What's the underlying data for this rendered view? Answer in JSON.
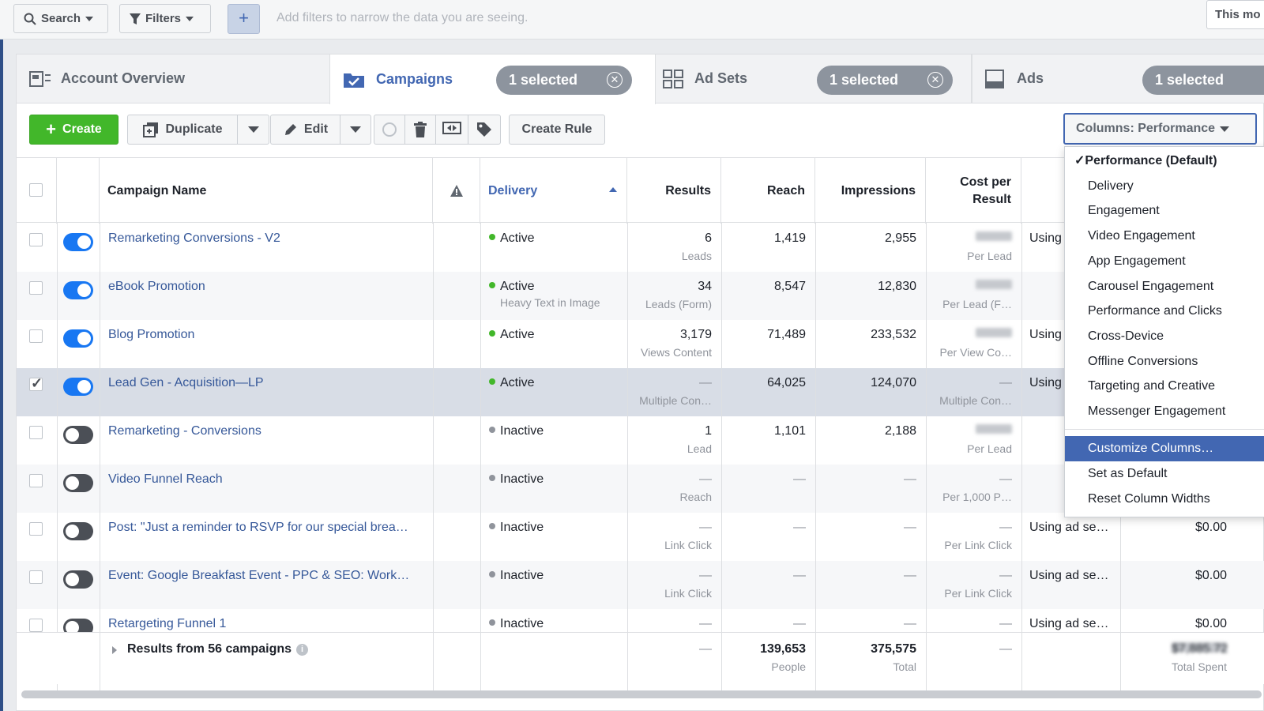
{
  "filter_bar": {
    "search_label": "Search",
    "filters_label": "Filters",
    "add_label": "+",
    "hint": "Add filters to narrow the data you are seeing.",
    "date_range": "This mo"
  },
  "tabs": [
    {
      "label": "Account Overview",
      "selected": ""
    },
    {
      "label": "Campaigns",
      "selected": "1 selected"
    },
    {
      "label": "Ad Sets",
      "selected": "1 selected"
    },
    {
      "label": "Ads",
      "selected": "1 selected"
    }
  ],
  "toolbar": {
    "create": "Create",
    "duplicate": "Duplicate",
    "edit": "Edit",
    "create_rule": "Create Rule",
    "columns": "Columns: Performance"
  },
  "headers": {
    "name": "Campaign Name",
    "delivery": "Delivery",
    "results": "Results",
    "reach": "Reach",
    "impressions": "Impressions",
    "cost_line1": "Cost per",
    "cost_line2": "Result"
  },
  "rows": [
    {
      "name": "Remarketing Conversions - V2",
      "on": true,
      "checked": false,
      "delivery": "Active",
      "delivery_sub": "",
      "results": "6",
      "results_sub": "Leads",
      "reach": "1,419",
      "impressions": "2,955",
      "cost": "$18.14",
      "cost_sub": "Per Lead",
      "budget": "Using",
      "spent": ""
    },
    {
      "name": "eBook Promotion",
      "on": true,
      "checked": false,
      "delivery": "Active",
      "delivery_sub": "Heavy Text in Image",
      "results": "34",
      "results_sub": "Leads (Form)",
      "reach": "8,547",
      "impressions": "12,830",
      "cost": "$17.47",
      "cost_sub": "Per Lead (F…",
      "budget": "",
      "spent": ""
    },
    {
      "name": "Blog Promotion",
      "on": true,
      "checked": false,
      "delivery": "Active",
      "delivery_sub": "",
      "results": "3,179",
      "results_sub": "Views Content",
      "reach": "71,489",
      "impressions": "233,532",
      "cost": "$0.23",
      "cost_sub": "Per View Co…",
      "budget": "Using",
      "spent": ""
    },
    {
      "name": "Lead Gen - Acquisition—LP",
      "on": true,
      "checked": true,
      "delivery": "Active",
      "delivery_sub": "",
      "results": "—",
      "results_sub": "Multiple Con…",
      "reach": "64,025",
      "impressions": "124,070",
      "cost": "—",
      "cost_sub": "Multiple Con…",
      "budget": "Using",
      "spent": ""
    },
    {
      "name": "Remarketing - Conversions",
      "on": false,
      "checked": false,
      "delivery": "Inactive",
      "delivery_sub": "",
      "results": "1",
      "results_sub": "Lead",
      "reach": "1,101",
      "impressions": "2,188",
      "cost": "$83.49",
      "cost_sub": "Per Lead",
      "budget": "",
      "spent": ""
    },
    {
      "name": "Video Funnel Reach",
      "on": false,
      "checked": false,
      "delivery": "Inactive",
      "delivery_sub": "",
      "results": "—",
      "results_sub": "Reach",
      "reach": "—",
      "impressions": "—",
      "cost": "—",
      "cost_sub": "Per 1,000 P…",
      "budget": "",
      "spent": ""
    },
    {
      "name": "Post: \"Just a reminder to RSVP for our special brea…",
      "on": false,
      "checked": false,
      "delivery": "Inactive",
      "delivery_sub": "",
      "results": "—",
      "results_sub": "Link Click",
      "reach": "—",
      "impressions": "—",
      "cost": "—",
      "cost_sub": "Per Link Click",
      "budget": "Using ad se…",
      "spent": "$0.00"
    },
    {
      "name": "Event: Google Breakfast Event - PPC & SEO: Work…",
      "on": false,
      "checked": false,
      "delivery": "Inactive",
      "delivery_sub": "",
      "results": "—",
      "results_sub": "Link Click",
      "reach": "—",
      "impressions": "—",
      "cost": "—",
      "cost_sub": "Per Link Click",
      "budget": "Using ad se…",
      "spent": "$0.00"
    },
    {
      "name": "Retargeting Funnel 1",
      "on": false,
      "checked": false,
      "delivery": "Inactive",
      "delivery_sub": "",
      "results": "—",
      "results_sub": "",
      "reach": "—",
      "impressions": "—",
      "cost": "—",
      "cost_sub": "",
      "budget": "Using ad se…",
      "spent": "$0.00"
    }
  ],
  "footer": {
    "label": "Results from 56 campaigns",
    "results": "—",
    "reach": "139,653",
    "reach_sub": "People",
    "impressions": "375,575",
    "impressions_sub": "Total",
    "cost": "—",
    "spent": "$7,885.72",
    "spent_sub": "Total Spent"
  },
  "columns_menu": {
    "items": [
      "Performance (Default)",
      "Delivery",
      "Engagement",
      "Video Engagement",
      "App Engagement",
      "Carousel Engagement",
      "Performance and Clicks",
      "Cross-Device",
      "Offline Conversions",
      "Targeting and Creative",
      "Messenger Engagement"
    ],
    "checked_index": 0,
    "actions": [
      "Customize Columns…",
      "Set as Default",
      "Reset Column Widths"
    ],
    "highlighted_action": 0
  },
  "colors": {
    "accent": "#4267b2",
    "link": "#365899",
    "green": "#42b72a",
    "active_dot": "#42b72a",
    "inactive_dot": "#90949c",
    "toggle_on": "#1877f2"
  }
}
